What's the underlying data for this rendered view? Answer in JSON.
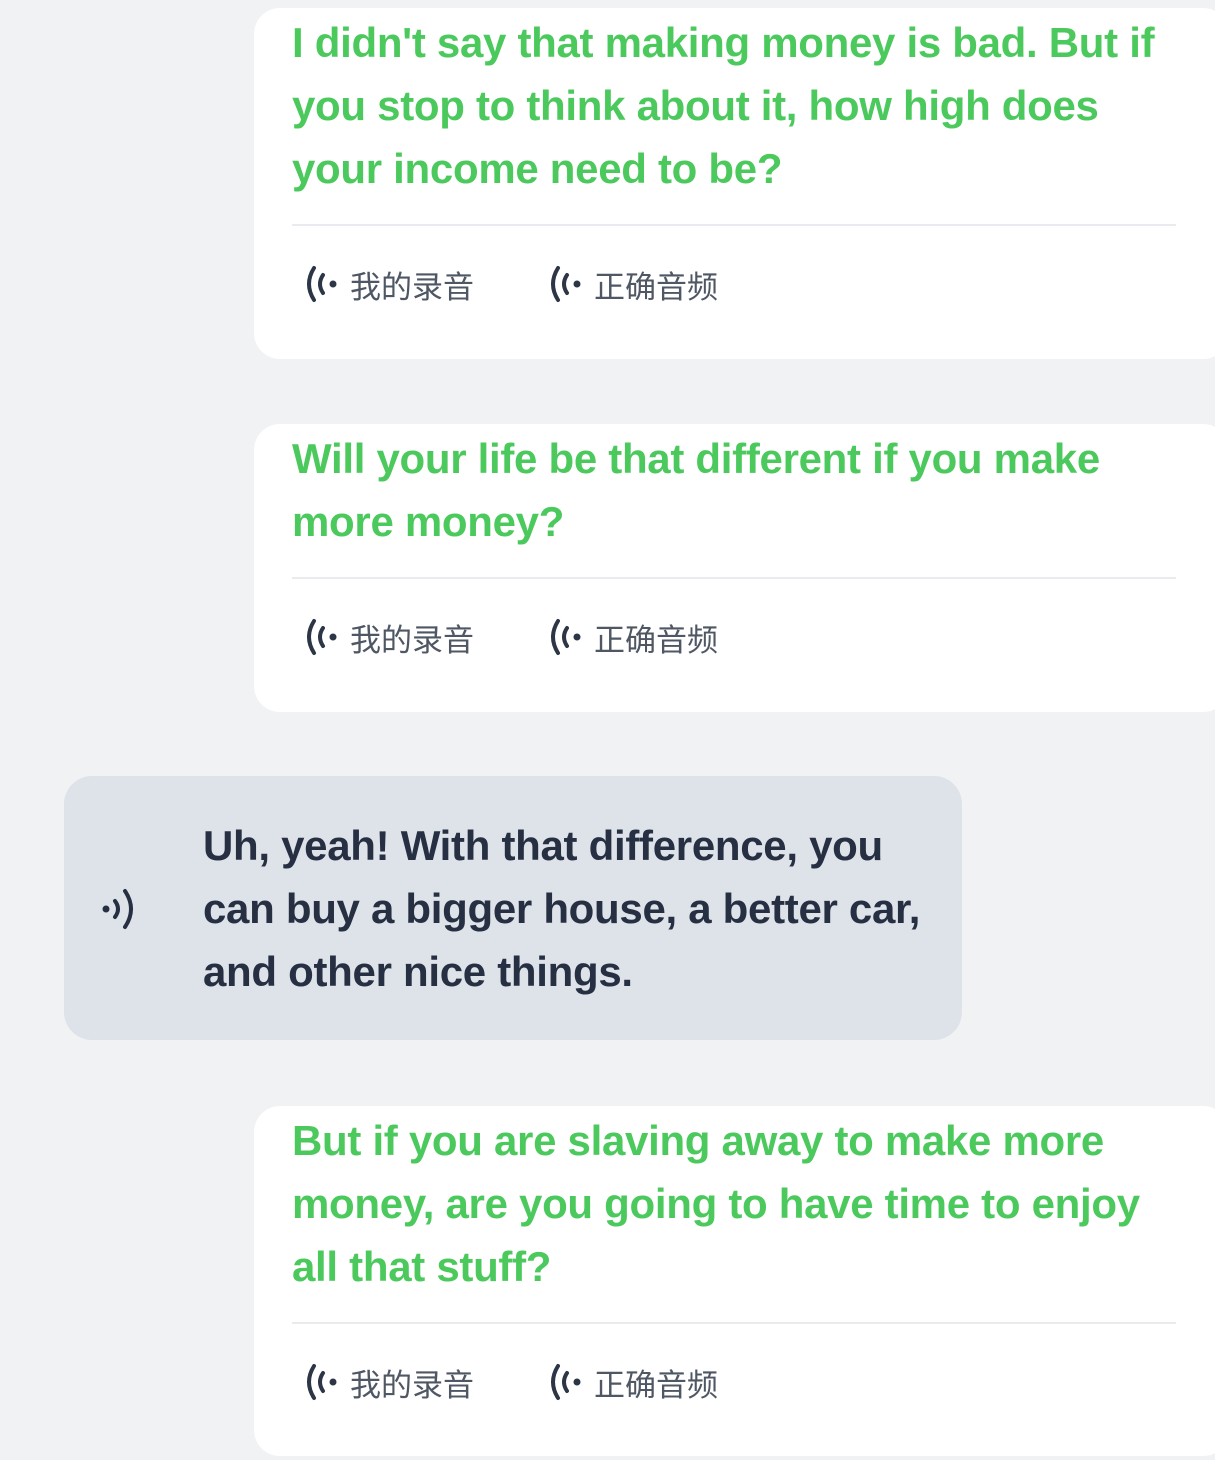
{
  "messages": [
    {
      "text": "I didn't say that making money is bad. But if you stop to think about it, how high does your income need to be?",
      "my_recording": "我的录音",
      "correct_audio": "正确音频"
    },
    {
      "text": "Will your life be that different if you make more money?",
      "my_recording": "我的录音",
      "correct_audio": "正确音频"
    },
    {
      "text": "But if you are slaving away to make more money, are you going to have time to enjoy all that stuff?",
      "my_recording": "我的录音",
      "correct_audio": "正确音频"
    }
  ],
  "bot_message": {
    "text": "Uh, yeah! With that difference, you can buy a bigger house, a better car, and other nice things."
  },
  "colors": {
    "user_text": "#4cc95d",
    "bot_text": "#273043",
    "background": "#f1f2f4",
    "bot_bubble": "#dee2e9",
    "card": "#ffffff"
  },
  "icons": {
    "audio_wave": "audio-wave-icon",
    "speaker": "speaker-icon"
  }
}
